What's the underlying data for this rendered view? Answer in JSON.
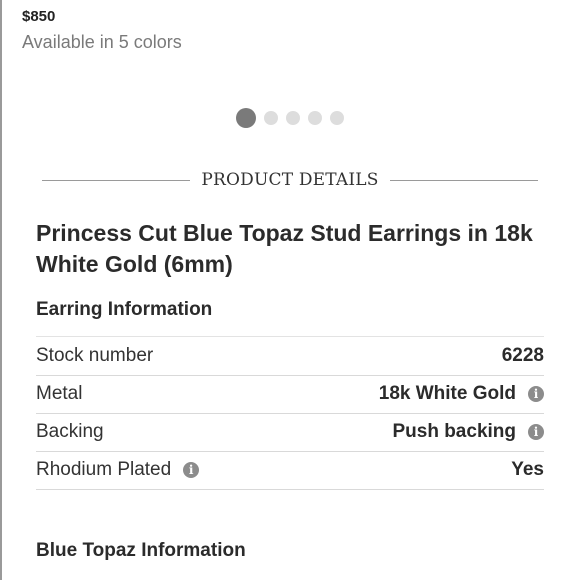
{
  "product": {
    "price": "$850",
    "colors_note": "Available in 5 colors",
    "title": "Princess Cut Blue Topaz Stud Earrings in 18k White Gold (6mm)"
  },
  "carousel": {
    "total": 5,
    "active_index": 0
  },
  "section": {
    "title": "PRODUCT DETAILS"
  },
  "earring_info": {
    "heading": "Earring Information",
    "rows": [
      {
        "label": "Stock number",
        "value": "6228",
        "info": ""
      },
      {
        "label": "Metal",
        "value": "18k White Gold",
        "info": "value"
      },
      {
        "label": "Backing",
        "value": "Push backing",
        "info": "value"
      },
      {
        "label": "Rhodium Plated",
        "value": "Yes",
        "info": "label"
      }
    ]
  },
  "stone_info": {
    "heading": "Blue Topaz Information"
  },
  "icons": {
    "info": "info-icon"
  },
  "colors": {
    "accent_dot": "#7a7a7a",
    "muted": "#7a7a7a",
    "rule": "#d9d9d9"
  }
}
